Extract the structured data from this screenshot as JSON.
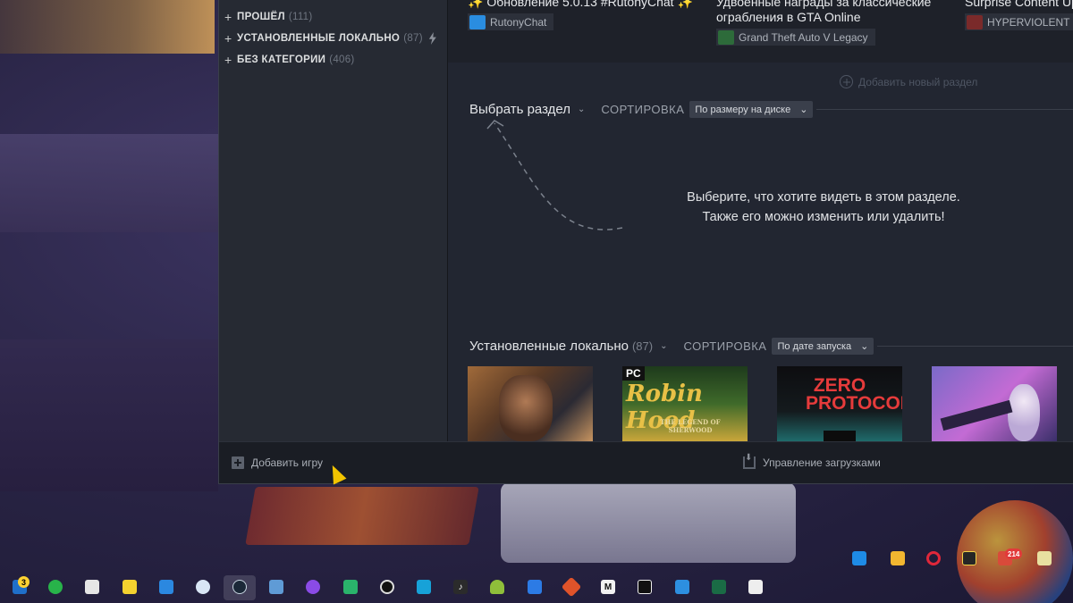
{
  "sidebar": {
    "categories": [
      {
        "label": "ПРОШЁЛ",
        "count": "(111)"
      },
      {
        "label": "УСТАНОВЛЕННЫЕ ЛОКАЛЬНО",
        "count": "(87)"
      },
      {
        "label": "БЕЗ КАТЕГОРИИ",
        "count": "(406)"
      }
    ]
  },
  "news": [
    {
      "title": "✨ Обновление 5.0.13 #RutonyChat ✨",
      "source": "RutonyChat",
      "icon": "rutonychat-icon",
      "color": "#2a8de0"
    },
    {
      "title": "Удвоенные награды за классические ограбления в GTA Online",
      "source": "Grand Theft Auto V Legacy",
      "icon": "gta-v-icon",
      "color": "#2d6b3a"
    },
    {
      "title": "Surprise Content Update & Development Update",
      "source": "HYPERVIOLENT",
      "icon": "hyperviolent-icon",
      "color": "#7a2a2a"
    }
  ],
  "shelf": {
    "add_section": "Добавить новый раздел",
    "select_section": "Выбрать раздел",
    "sort_label": "СОРТИРОВКА",
    "sort_value": "По размеру на диске",
    "hint_line1": "Выберите, что хотите видеть в этом разделе.",
    "hint_line2": "Также его можно изменить или удалить!"
  },
  "installed": {
    "title": "Установленные локально",
    "count": "(87)",
    "sort_label": "СОРТИРОВКА",
    "sort_value": "По дате запуска",
    "tiles": [
      {
        "name": "game-tile-1",
        "caption": ""
      },
      {
        "name": "robin-hood-tile",
        "caption": "Robin Hood",
        "badge": "PC",
        "subtitle": "THE LEGEND OF SHERWOOD"
      },
      {
        "name": "zero-protocol-tile",
        "caption": "ZERO PROTOCOL"
      },
      {
        "name": "anime-game-tile",
        "caption": ""
      }
    ]
  },
  "bottom_bar": {
    "add_game": "Добавить игру",
    "downloads": "Управление загрузками"
  },
  "taskbar": {
    "outlook_badge": "3",
    "mail_badge": "214"
  },
  "colors": {
    "accent": "#1a9fff",
    "cursor": "#f2c400"
  }
}
